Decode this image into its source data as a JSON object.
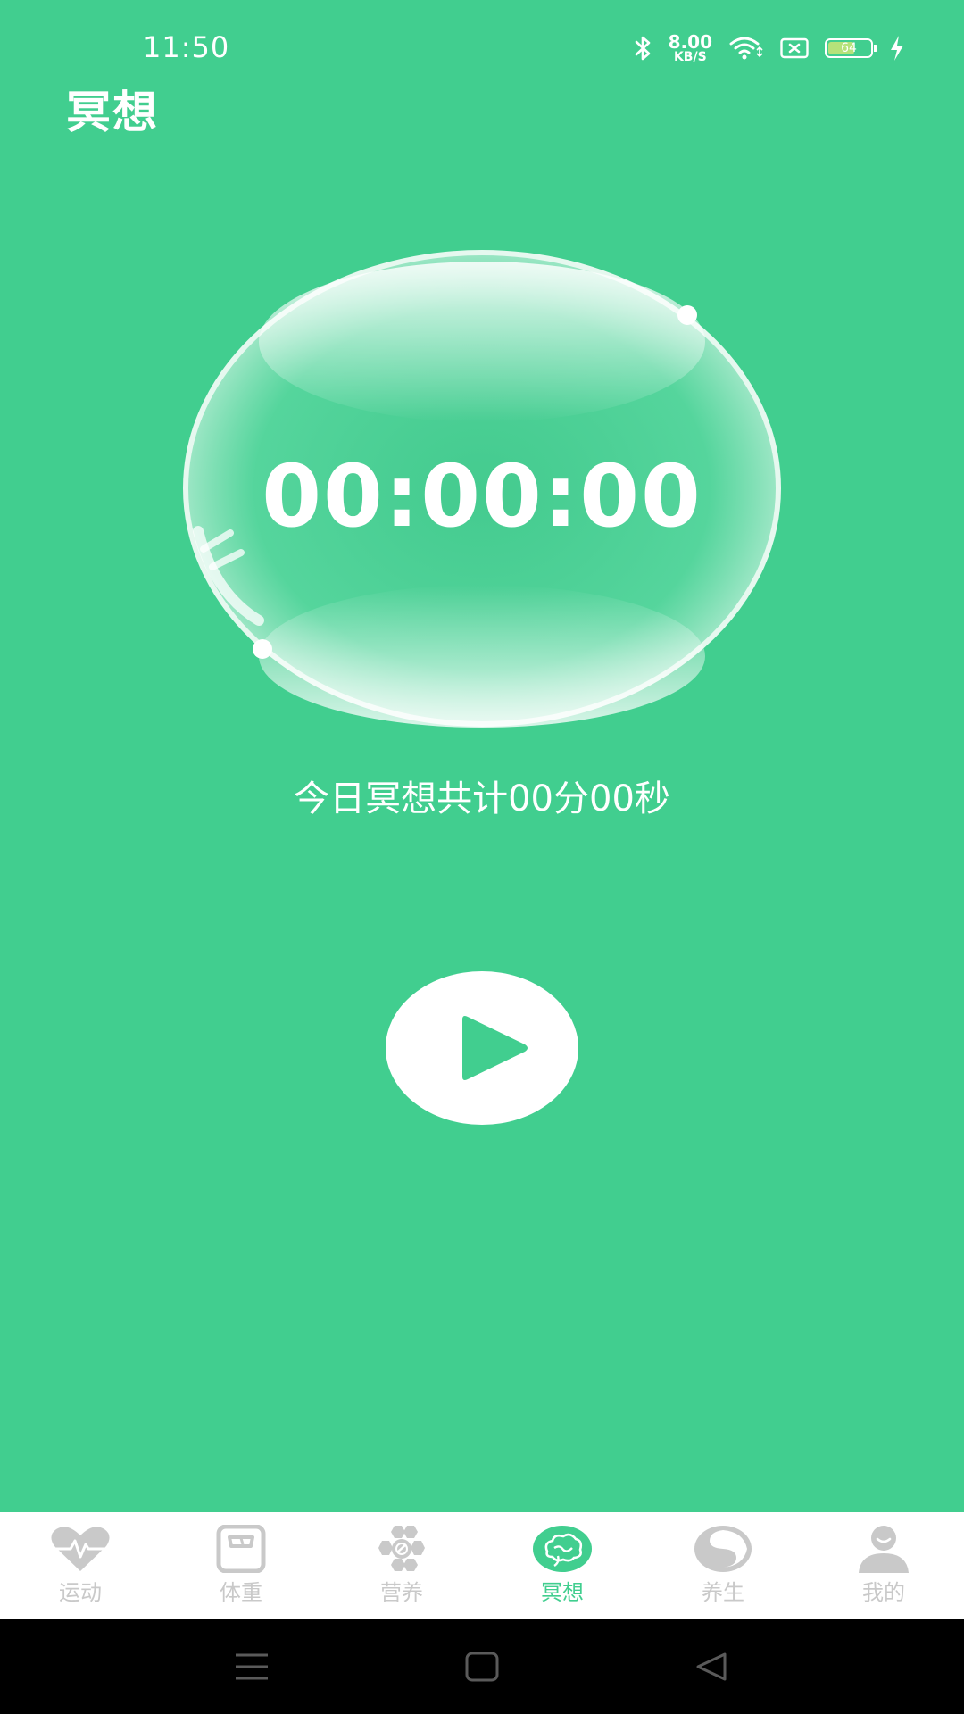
{
  "status_bar": {
    "time": "11:50",
    "net_speed_value": "8.00",
    "net_speed_unit": "KB/S",
    "battery_level": "64",
    "battery_fraction": 0.64
  },
  "page": {
    "title": "冥想"
  },
  "timer": {
    "display": "00:00:00",
    "today_total": "今日冥想共计00分00秒"
  },
  "bottom_nav": {
    "items": [
      {
        "label": "运动",
        "icon": "heart-pulse-icon"
      },
      {
        "label": "体重",
        "icon": "scale-icon"
      },
      {
        "label": "营养",
        "icon": "honeycomb-icon"
      },
      {
        "label": "冥想",
        "icon": "brain-icon",
        "active": true
      },
      {
        "label": "养生",
        "icon": "yin-yang-icon"
      },
      {
        "label": "我的",
        "icon": "user-icon"
      }
    ]
  },
  "colors": {
    "background": "#41CE8F",
    "inactive": "#C9C9C9",
    "active": "#41CE8F"
  }
}
